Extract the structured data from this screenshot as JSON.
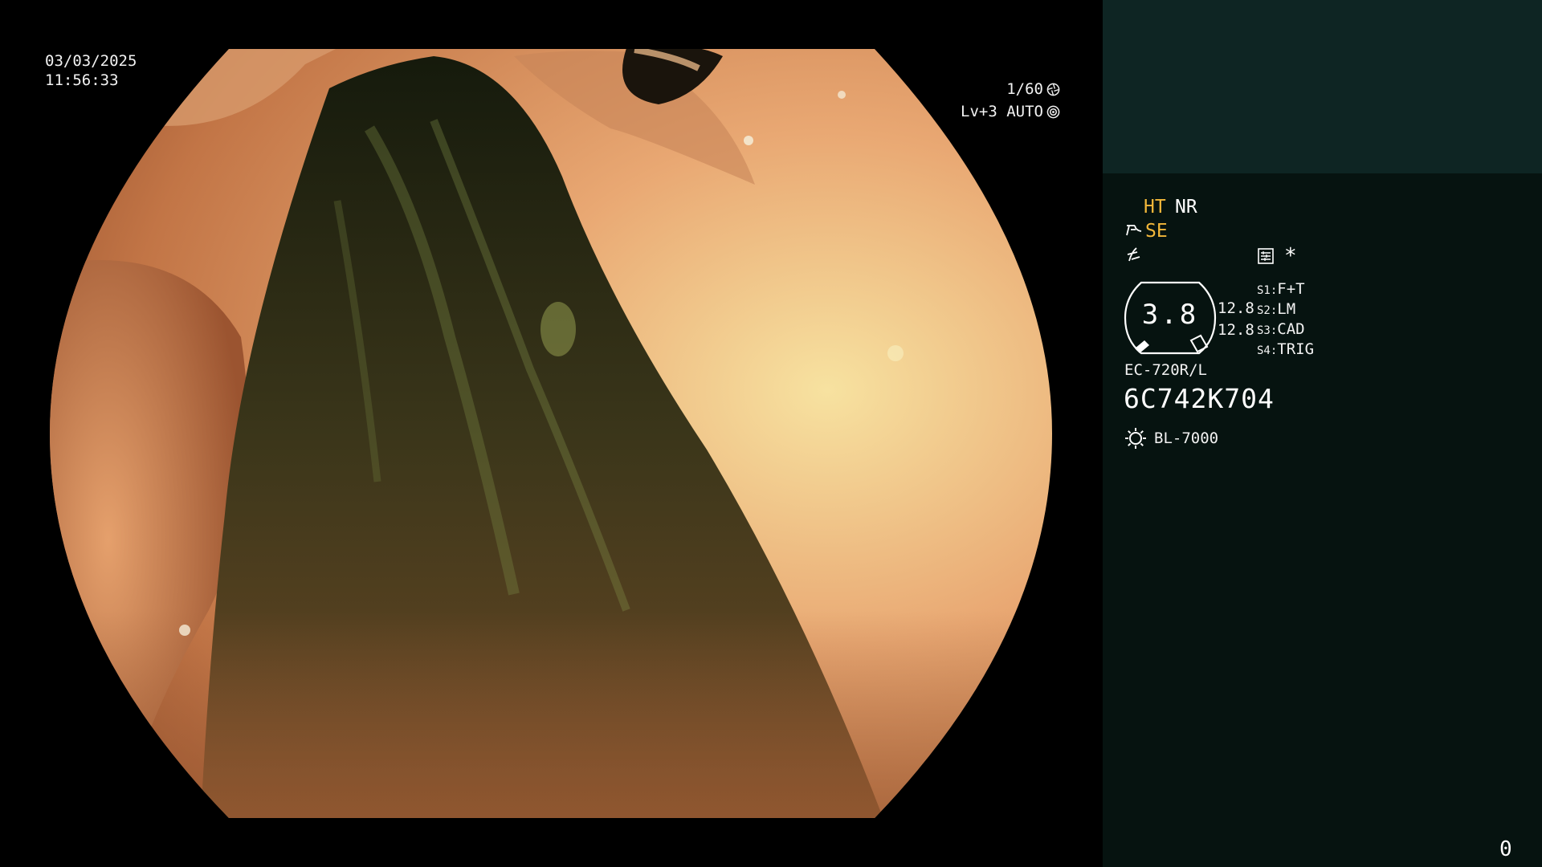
{
  "osd": {
    "date": "03/03/2025",
    "time": "11:56:33",
    "shutter": "1/60",
    "level": "Lv+3 AUTO"
  },
  "panel": {
    "ht": "HT",
    "nr": "NR",
    "se": "SE",
    "asterisk": "*",
    "gauge_value": "3.8",
    "gauge_side_1": "12.8",
    "gauge_side_2": "12.8",
    "settings": [
      {
        "key": "S1:",
        "value": "F+T"
      },
      {
        "key": "S2:",
        "value": "LM"
      },
      {
        "key": "S3:",
        "value": "CAD"
      },
      {
        "key": "S4:",
        "value": "TRIG"
      }
    ],
    "scope_model": "EC-720R/L",
    "serial": "6C742K704",
    "light_source": "BL-7000",
    "counter": "0"
  },
  "icons": {
    "shutter": "aperture-icon",
    "auto": "iris-icon",
    "se": "structure-enhance-icon",
    "flag": "color-mode-icon",
    "menu": "memory-icon",
    "gauge": "zoom-gauge-icon",
    "light": "light-source-icon"
  },
  "colors": {
    "background": "#000000",
    "panel_top": "#0e2523",
    "panel": "#061310",
    "highlight": "#f2b73a"
  }
}
